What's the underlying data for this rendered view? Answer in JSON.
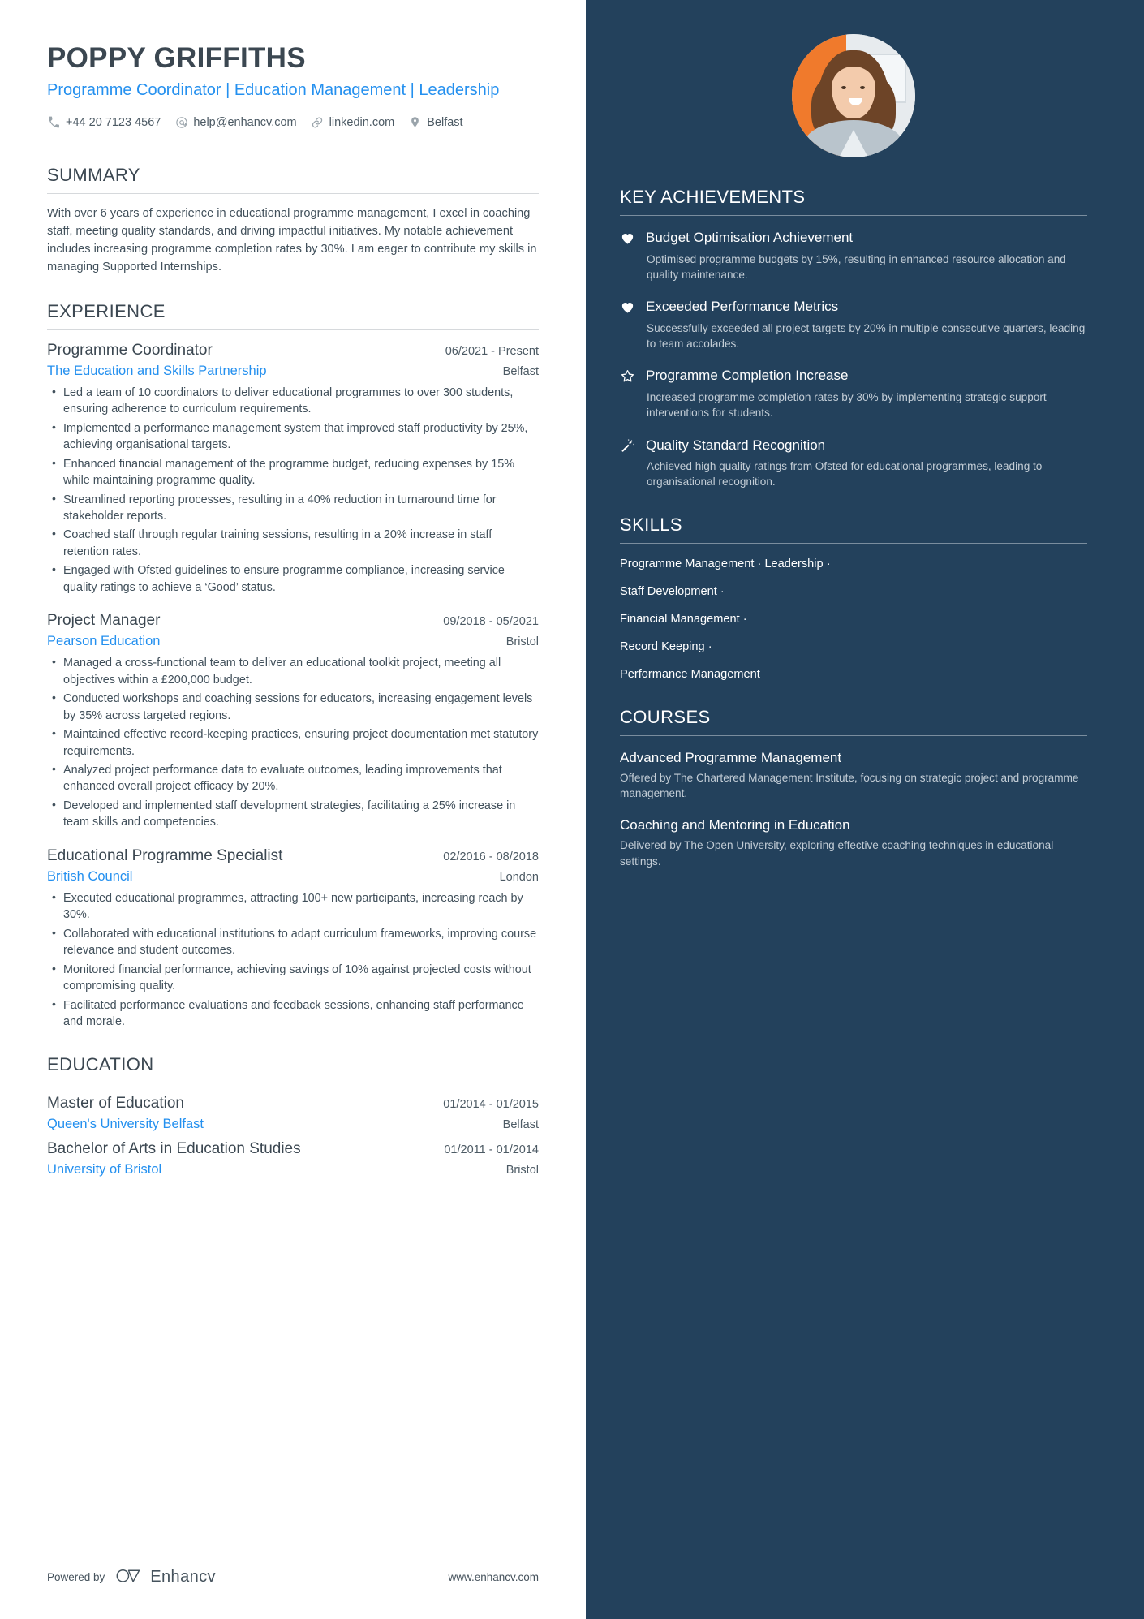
{
  "header": {
    "name": "POPPY GRIFFITHS",
    "headline": "Programme Coordinator | Education Management | Leadership",
    "contacts": [
      {
        "icon": "phone-icon",
        "text": "+44 20 7123 4567"
      },
      {
        "icon": "email-icon",
        "text": "help@enhancv.com"
      },
      {
        "icon": "link-icon",
        "text": "linkedin.com"
      },
      {
        "icon": "location-pin-icon",
        "text": "Belfast"
      }
    ]
  },
  "summary": {
    "title": "SUMMARY",
    "text": "With over 6 years of experience in educational programme management, I excel in coaching staff, meeting quality standards, and driving impactful initiatives. My notable achievement includes increasing programme completion rates by 30%. I am eager to contribute my skills in managing Supported Internships."
  },
  "experience": {
    "title": "EXPERIENCE",
    "jobs": [
      {
        "title": "Programme Coordinator",
        "dates": "06/2021 - Present",
        "company": "The Education and Skills Partnership",
        "location": "Belfast",
        "bullets": [
          "Led a team of 10 coordinators to deliver educational programmes to over 300 students, ensuring adherence to curriculum requirements.",
          "Implemented a performance management system that improved staff productivity by 25%, achieving organisational targets.",
          "Enhanced financial management of the programme budget, reducing expenses by 15% while maintaining programme quality.",
          "Streamlined reporting processes, resulting in a 40% reduction in turnaround time for stakeholder reports.",
          "Coached staff through regular training sessions, resulting in a 20% increase in staff retention rates.",
          "Engaged with Ofsted guidelines to ensure programme compliance, increasing service quality ratings to achieve a ‘Good’ status."
        ]
      },
      {
        "title": "Project Manager",
        "dates": "09/2018 - 05/2021",
        "company": "Pearson Education",
        "location": "Bristol",
        "bullets": [
          "Managed a cross-functional team to deliver an educational toolkit project, meeting all objectives within a £200,000 budget.",
          "Conducted workshops and coaching sessions for educators, increasing engagement levels by 35% across targeted regions.",
          "Maintained effective record-keeping practices, ensuring project documentation met statutory requirements.",
          "Analyzed project performance data to evaluate outcomes, leading improvements that enhanced overall project efficacy by 20%.",
          "Developed and implemented staff development strategies, facilitating a 25% increase in team skills and competencies."
        ]
      },
      {
        "title": "Educational Programme Specialist",
        "dates": "02/2016 - 08/2018",
        "company": "British Council",
        "location": "London",
        "bullets": [
          "Executed educational programmes, attracting 100+ new participants, increasing reach by 30%.",
          "Collaborated with educational institutions to adapt curriculum frameworks, improving course relevance and student outcomes.",
          "Monitored financial performance, achieving savings of 10% against projected costs without compromising quality.",
          "Facilitated performance evaluations and feedback sessions, enhancing staff performance and morale."
        ]
      }
    ]
  },
  "education": {
    "title": "EDUCATION",
    "entries": [
      {
        "degree": "Master of Education",
        "dates": "01/2014 - 01/2015",
        "school": "Queen's University Belfast",
        "location": "Belfast"
      },
      {
        "degree": "Bachelor of Arts in Education Studies",
        "dates": "01/2011 - 01/2014",
        "school": "University of Bristol",
        "location": "Bristol"
      }
    ]
  },
  "footer": {
    "powered_label": "Powered by",
    "brand": "Enhancv",
    "site": "www.enhancv.com"
  },
  "sidebar": {
    "achievements": {
      "title": "KEY ACHIEVEMENTS",
      "items": [
        {
          "icon": "heart-icon",
          "title": "Budget Optimisation Achievement",
          "desc": "Optimised programme budgets by 15%, resulting in enhanced resource allocation and quality maintenance."
        },
        {
          "icon": "heart-icon",
          "title": "Exceeded Performance Metrics",
          "desc": "Successfully exceeded all project targets by 20% in multiple consecutive quarters, leading to team accolades."
        },
        {
          "icon": "star-outline-icon",
          "title": "Programme Completion Increase",
          "desc": "Increased programme completion rates by 30% by implementing strategic support interventions for students."
        },
        {
          "icon": "magic-wand-icon",
          "title": "Quality Standard Recognition",
          "desc": "Achieved high quality ratings from Ofsted for educational programmes, leading to organisational recognition."
        }
      ]
    },
    "skills": {
      "title": "SKILLS",
      "lines": [
        "Programme Management · Leadership ·",
        "Staff Development ·",
        "Financial Management ·",
        "Record Keeping ·",
        "Performance Management"
      ]
    },
    "courses": {
      "title": "COURSES",
      "items": [
        {
          "title": "Advanced Programme Management",
          "desc": "Offered by The Chartered Management Institute, focusing on strategic project and programme management."
        },
        {
          "title": "Coaching and Mentoring in Education",
          "desc": "Delivered by The Open University, exploring effective coaching techniques in educational settings."
        }
      ]
    }
  },
  "colors": {
    "sidebar_bg": "#23415c",
    "accent_blue": "#2490ef",
    "heading": "#3b4751",
    "body_text": "#41505b",
    "muted_sidebar_text": "#c3cdd6"
  }
}
